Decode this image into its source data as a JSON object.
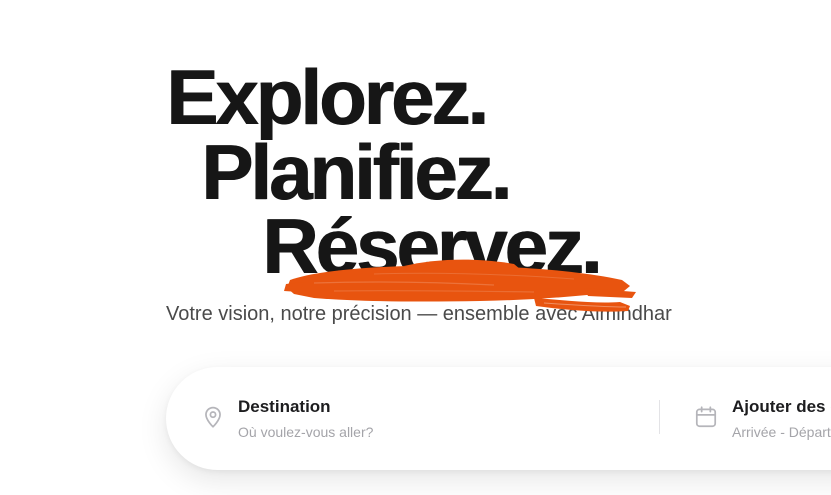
{
  "hero": {
    "line1": "Explorez.",
    "line2": "Planifiez.",
    "line3": "Réservez.",
    "subtitle": "Votre vision, notre précision — ensemble avec Almindhar",
    "accent_color": "#E8540F"
  },
  "search": {
    "destination": {
      "label": "Destination",
      "placeholder": "Où voulez-vous aller?",
      "icon": "map-pin-icon"
    },
    "dates": {
      "label": "Ajouter des dates",
      "placeholder": "Arrivée - Départ",
      "icon": "calendar-icon"
    }
  }
}
